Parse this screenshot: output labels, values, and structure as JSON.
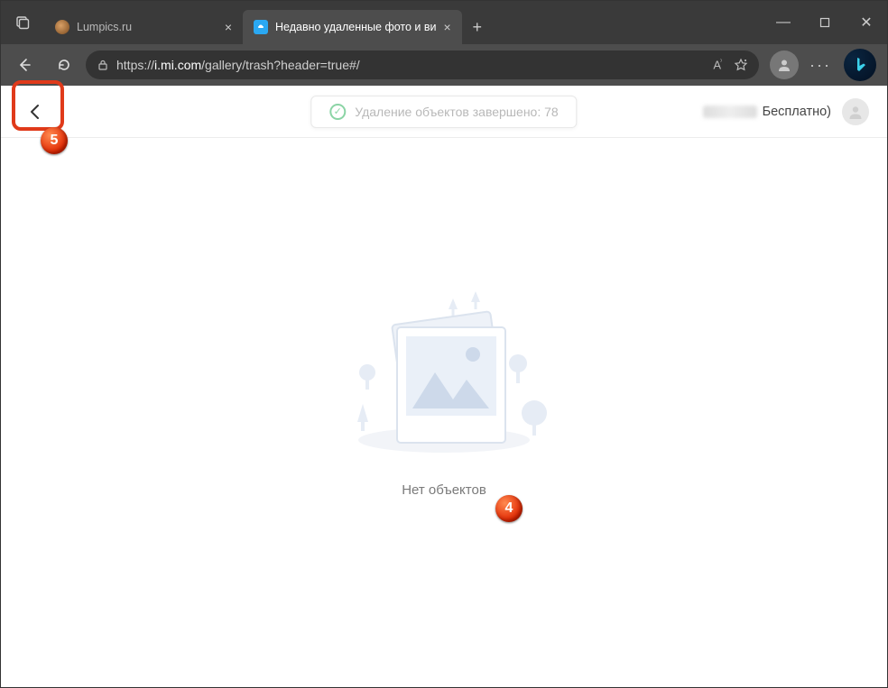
{
  "browser": {
    "tabs": [
      {
        "title": "Lumpics.ru",
        "active": false
      },
      {
        "title": "Недавно удаленные фото и ви",
        "active": true
      }
    ],
    "url_prefix": "https://",
    "url_domain": "i.mi.com",
    "url_path": "/gallery/trash?header=true#/",
    "win_min": "—",
    "win_max": "▢",
    "win_close": "✕",
    "newtab": "+",
    "more": "···"
  },
  "page": {
    "toast": "Удаление объектов завершено: 78",
    "user_plan": "Бесплатно)",
    "empty_label": "Нет объектов"
  },
  "annotations": {
    "badge4": "4",
    "badge5": "5"
  }
}
